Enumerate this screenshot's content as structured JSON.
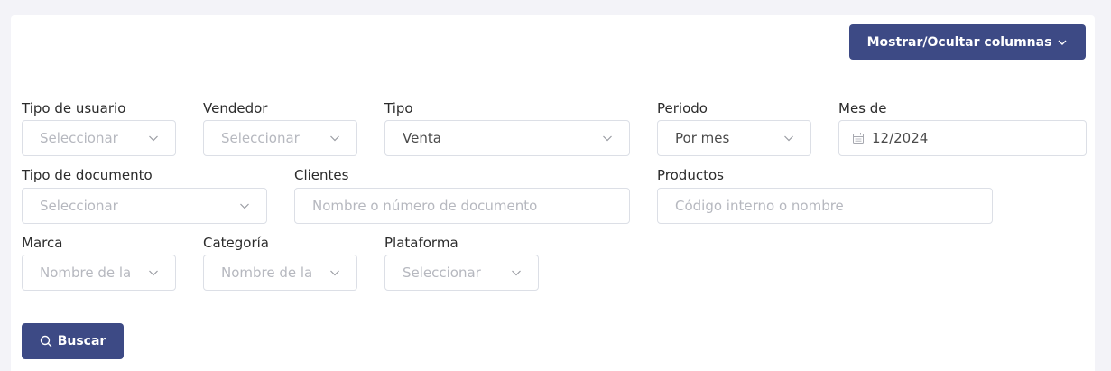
{
  "toolbar": {
    "toggle_columns_label": "Mostrar/Ocultar columnas"
  },
  "filters": {
    "user_type": {
      "label": "Tipo de usuario",
      "placeholder": "Seleccionar"
    },
    "seller": {
      "label": "Vendedor",
      "placeholder": "Seleccionar"
    },
    "type": {
      "label": "Tipo",
      "value": "Venta"
    },
    "period": {
      "label": "Periodo",
      "value": "Por mes"
    },
    "month": {
      "label": "Mes de",
      "value": "12/2024"
    },
    "document_type": {
      "label": "Tipo de documento",
      "placeholder": "Seleccionar"
    },
    "clients": {
      "label": "Clientes",
      "placeholder": "Nombre o número de documento"
    },
    "products": {
      "label": "Productos",
      "placeholder": "Código interno o nombre"
    },
    "brand": {
      "label": "Marca",
      "placeholder": "Nombre de la"
    },
    "category": {
      "label": "Categoría",
      "placeholder": "Nombre de la"
    },
    "platform": {
      "label": "Plataforma",
      "placeholder": "Seleccionar"
    }
  },
  "actions": {
    "search_label": "Buscar"
  },
  "colors": {
    "primary": "#3d4a85",
    "background": "#f3f3f8",
    "border": "#dcdfe6",
    "placeholder": "#b6b8bf"
  }
}
